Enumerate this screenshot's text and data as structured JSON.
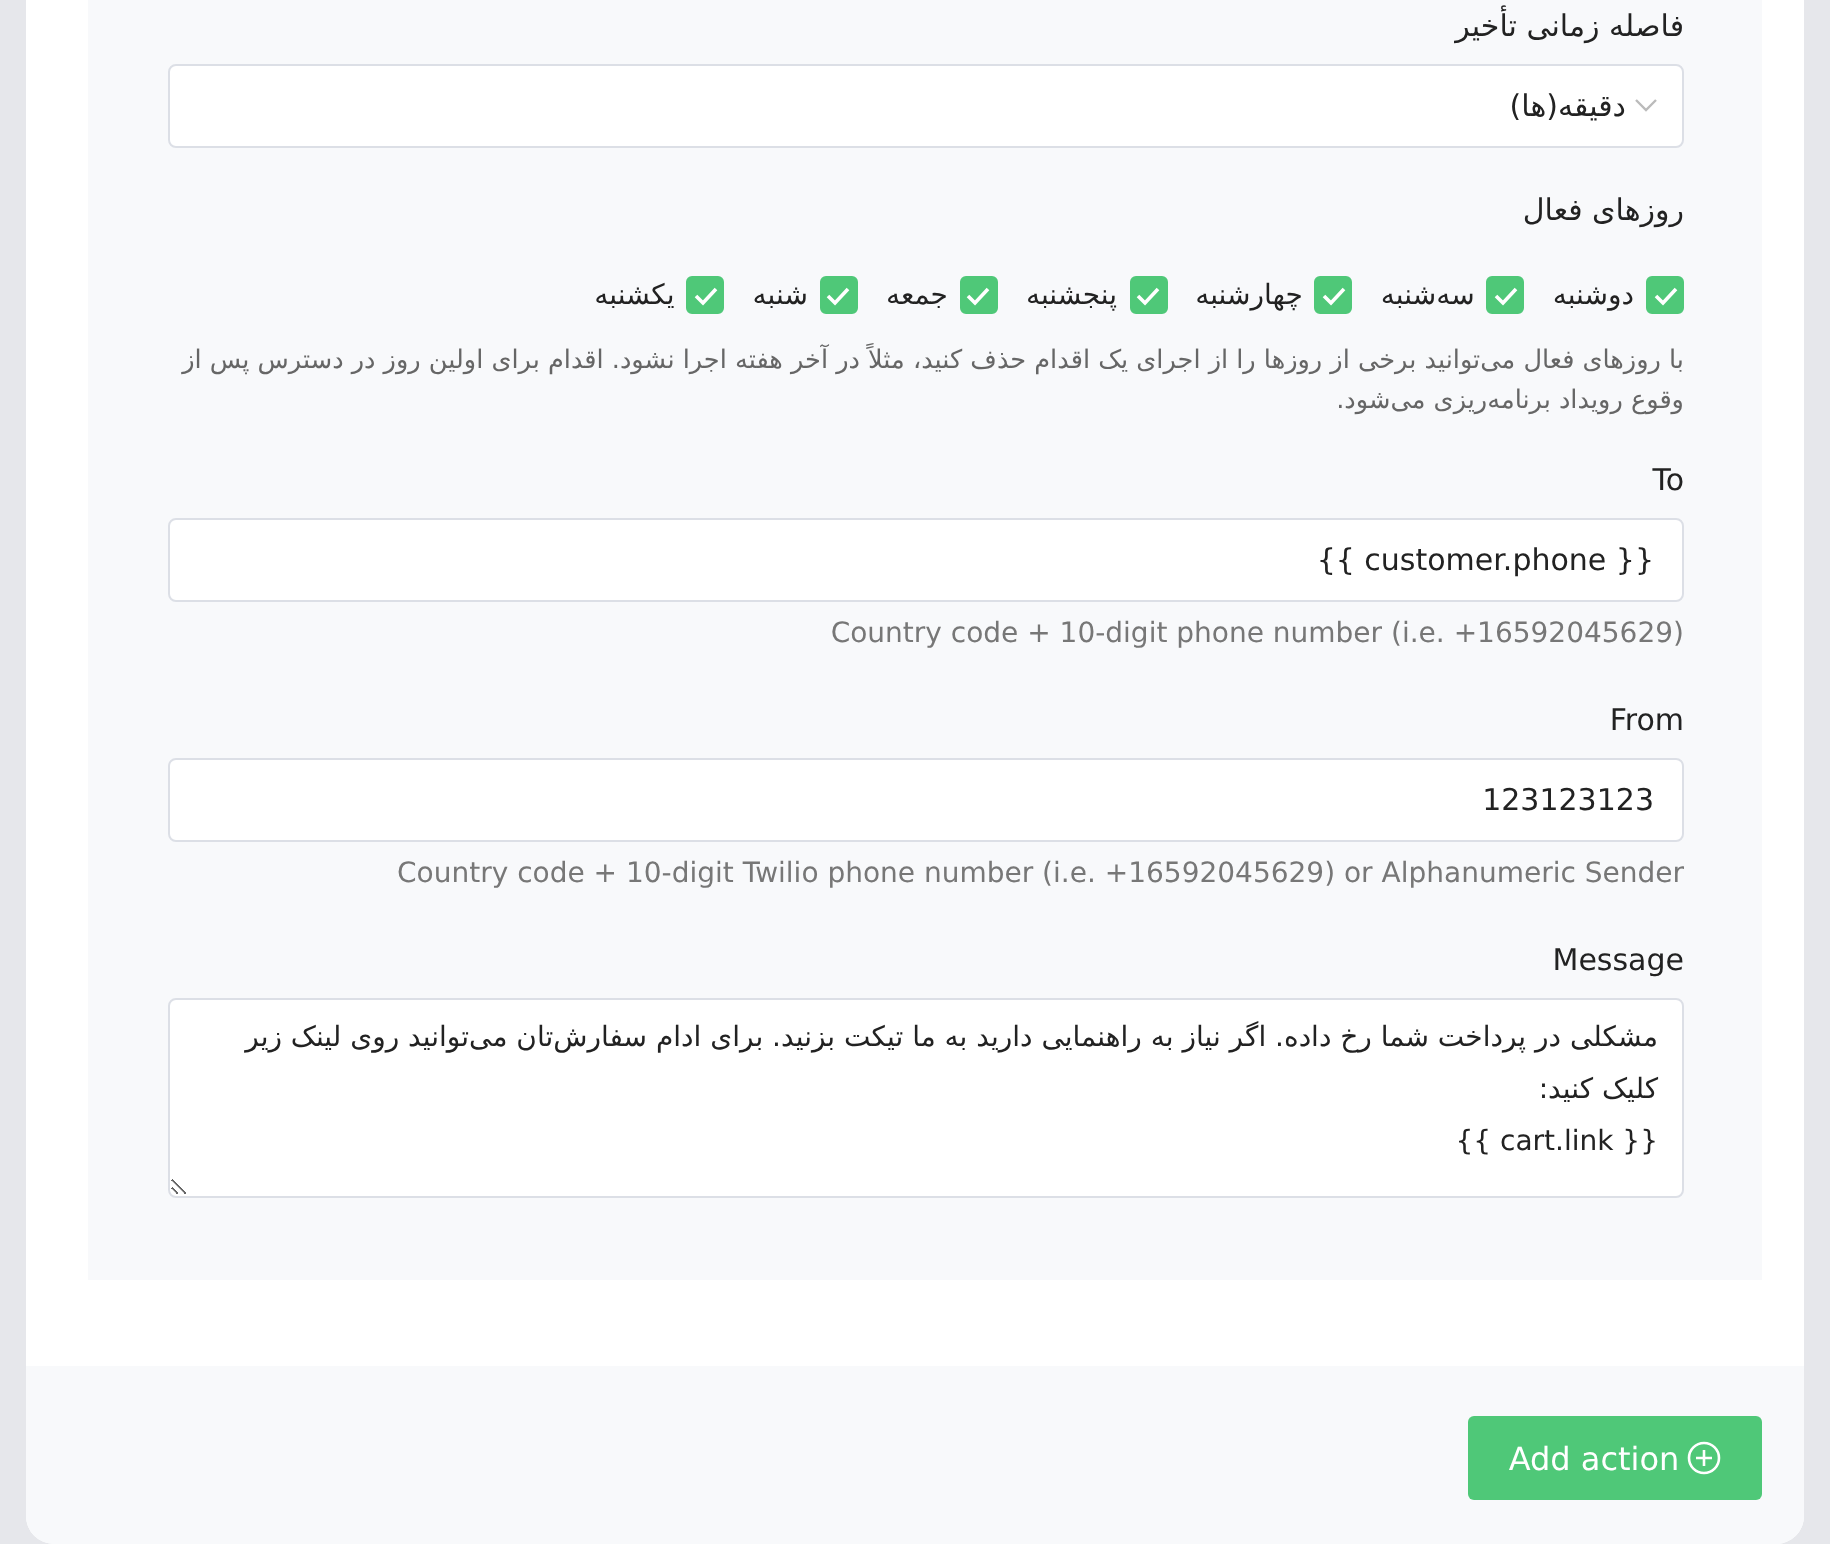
{
  "delay": {
    "label": "فاصله زمانی تأخیر",
    "value": "دقیقه(ها)"
  },
  "active_days": {
    "label": "روزهای فعال",
    "days": [
      {
        "label": "دوشنبه",
        "checked": true
      },
      {
        "label": "سه‌شنبه",
        "checked": true
      },
      {
        "label": "چهارشنبه",
        "checked": true
      },
      {
        "label": "پنجشنبه",
        "checked": true
      },
      {
        "label": "جمعه",
        "checked": true
      },
      {
        "label": "شنبه",
        "checked": true
      },
      {
        "label": "یکشنبه",
        "checked": true
      }
    ],
    "help": "با روزهای فعال می‌توانید برخی از روزها را از اجرای یک اقدام حذف کنید، مثلاً در آخر هفته اجرا نشود. اقدام برای اولین روز در دسترس پس از وقوع رویداد برنامه‌ریزی می‌شود."
  },
  "to": {
    "label": "To",
    "value": "{{ customer.phone }}",
    "hint": "Country code + 10-digit phone number (i.e. +16592045629)"
  },
  "from": {
    "label": "From",
    "value": "123123123",
    "hint": "Country code + 10-digit Twilio phone number (i.e. +16592045629) or Alphanumeric Sender"
  },
  "message": {
    "label": "Message",
    "value": "مشکلی در پرداخت شما رخ داده. اگر نیاز به راهنمایی دارید به ما تیکت بزنید. برای ادام سفارش‌تان می‌توانید روی لینک زیر کلیک کنید:\n{{ cart.link }}"
  },
  "footer": {
    "button": "Add action"
  }
}
